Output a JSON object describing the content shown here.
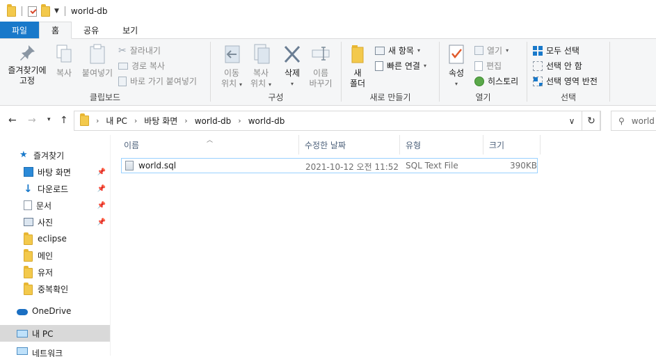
{
  "window": {
    "title": "world-db"
  },
  "tabs": [
    {
      "label": "파일"
    },
    {
      "label": "홈"
    },
    {
      "label": "공유"
    },
    {
      "label": "보기"
    }
  ],
  "ribbon": {
    "clipboard": {
      "pin_quick": [
        "즐겨찾기에",
        "고정"
      ],
      "copy": "복사",
      "paste": "붙여넣기",
      "cut": "잘라내기",
      "copy_path": "경로 복사",
      "paste_shortcut": "바로 가기 붙여넣기",
      "group": "클립보드"
    },
    "organize": {
      "move_to": [
        "이동",
        "위치"
      ],
      "copy_to": [
        "복사",
        "위치"
      ],
      "delete": "삭제",
      "rename": [
        "이름",
        "바꾸기"
      ],
      "group": "구성"
    },
    "new": {
      "new_folder": [
        "새",
        "폴더"
      ],
      "new_item": "새 항목",
      "easy_access": "빠른 연결",
      "group": "새로 만들기"
    },
    "open": {
      "properties": "속성",
      "open": "열기",
      "edit": "편집",
      "history": "히스토리",
      "group": "열기"
    },
    "select": {
      "select_all": "모두 선택",
      "select_none": "선택 안 함",
      "invert": "선택 영역 반전",
      "group": "선택"
    }
  },
  "address": {
    "crumbs": [
      "내 PC",
      "바탕 화면",
      "world-db",
      "world-db"
    ],
    "search_placeholder": "world"
  },
  "nav": {
    "quick_access": "즐겨찾기",
    "items": [
      {
        "label": "바탕 화면",
        "pinned": true
      },
      {
        "label": "다운로드",
        "pinned": true
      },
      {
        "label": "문서",
        "pinned": true
      },
      {
        "label": "사진",
        "pinned": true
      },
      {
        "label": "eclipse",
        "pinned": false
      },
      {
        "label": "메인",
        "pinned": false
      },
      {
        "label": "유저",
        "pinned": false
      },
      {
        "label": "중복확인",
        "pinned": false
      }
    ],
    "onedrive": "OneDrive",
    "this_pc": "내 PC",
    "network": "네트워크"
  },
  "columns": [
    "이름",
    "수정한 날짜",
    "유형",
    "크기"
  ],
  "files": [
    {
      "name": "world.sql",
      "modified": "2021-10-12 오전 11:52",
      "type": "SQL Text File",
      "size": "390KB"
    }
  ],
  "colors": {
    "file_tab": "#1979ca",
    "folder": "#f3c94c",
    "selected_border": "#99d1ff",
    "nav_selected": "#d9d9d9"
  }
}
